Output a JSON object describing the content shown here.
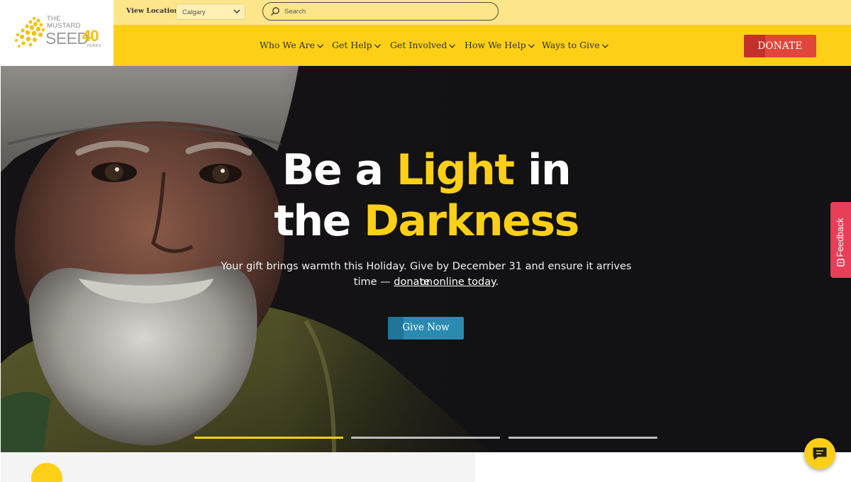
{
  "logo": {
    "line1": "THE",
    "line2": "MUSTARD",
    "seed": "SEED",
    "anniversary": "40",
    "years": "YEARS"
  },
  "topbar": {
    "location_label": "View Location:",
    "location_value": "Calgary",
    "search_placeholder": "Search"
  },
  "nav": {
    "items": [
      {
        "label": "Who We Are"
      },
      {
        "label": "Get Help"
      },
      {
        "label": "Get Involved"
      },
      {
        "label": "How We Help"
      },
      {
        "label": "Ways to Give"
      }
    ],
    "donate_label": "DONATE"
  },
  "hero": {
    "headline_a": "Be a ",
    "headline_b": "Light",
    "headline_c": " in",
    "headline_d": "the ",
    "headline_e": "Darkness",
    "sub_line1": "Your gift brings warmth this Holiday. Give by December 31 and ensure it arrives on",
    "sub_line2_pre": "time — ",
    "sub_link": "donate online today",
    "sub_line2_post": ".",
    "cta_label": "Give Now",
    "slides_total": 3,
    "slide_active": 1
  },
  "feedback": {
    "label": "Feedback"
  },
  "colors": {
    "brand_yellow": "#fdd017",
    "topbar_yellow": "#fde68a",
    "donate_red": "#e0463a",
    "cta_blue": "#2a8ab0",
    "feedback_pink": "#e83e57",
    "hero_bg": "#121113"
  },
  "icons": {
    "location_dropdown": "chevron-down-icon",
    "search": "search-icon",
    "nav_dropdown": "chevron-down-icon",
    "feedback": "feedback-icon",
    "chat": "chat-icon"
  }
}
